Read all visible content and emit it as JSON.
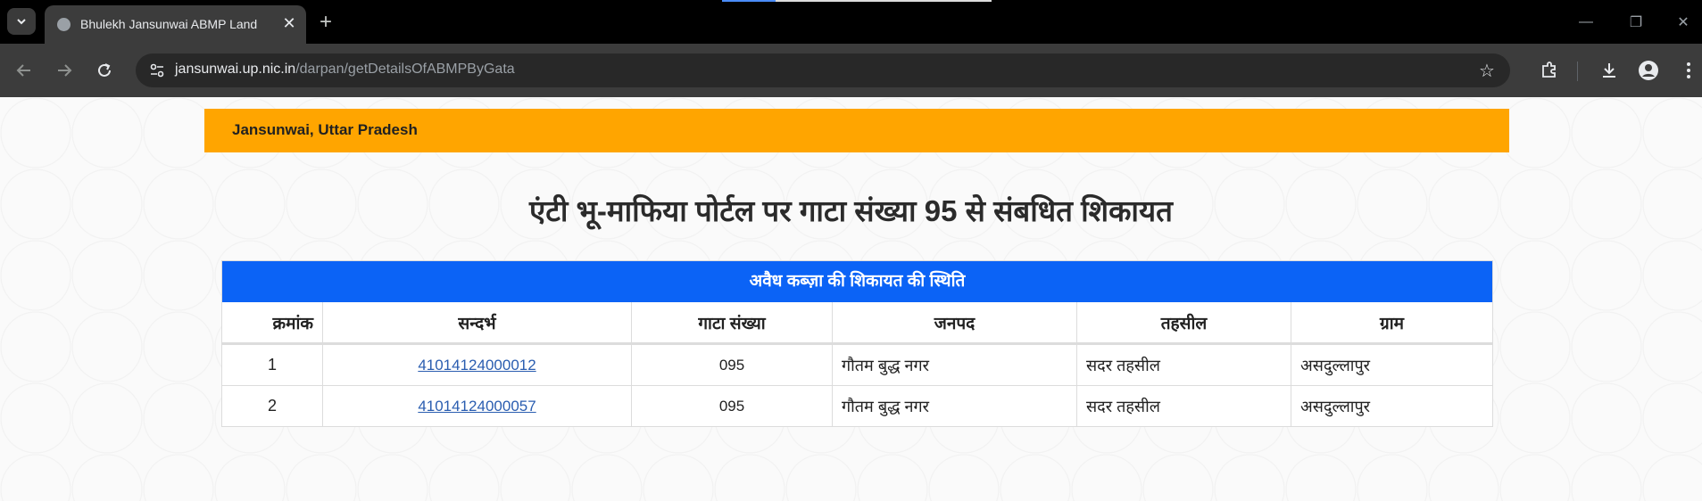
{
  "browser": {
    "tab_title": "Bhulekh Jansunwai ABMP Land",
    "url_host": "jansunwai.up.nic.in",
    "url_path": "/darpan/getDetailsOfABMPByGata"
  },
  "page": {
    "banner_text": "Jansunwai, Uttar Pradesh",
    "heading": "एंटी भू-माफिया पोर्टल पर गाटा संख्या 95 से संबधित शिकायत",
    "table": {
      "caption": "अवैध कब्ज़ा की शिकायत की स्थिति",
      "headers": [
        "क्रमांक",
        "सन्दर्भ",
        "गाटा संख्या",
        "जनपद",
        "तहसील",
        "ग्राम"
      ],
      "rows": [
        {
          "sno": "1",
          "ref": "41014124000012",
          "gata": "095",
          "district": "गौतम बुद्ध नगर",
          "tehsil": "सदर तहसील",
          "village": "असदुल्लापुर"
        },
        {
          "sno": "2",
          "ref": "41014124000057",
          "gata": "095",
          "district": "गौतम बुद्ध नगर",
          "tehsil": "सदर तहसील",
          "village": "असदुल्लापुर"
        }
      ]
    }
  }
}
